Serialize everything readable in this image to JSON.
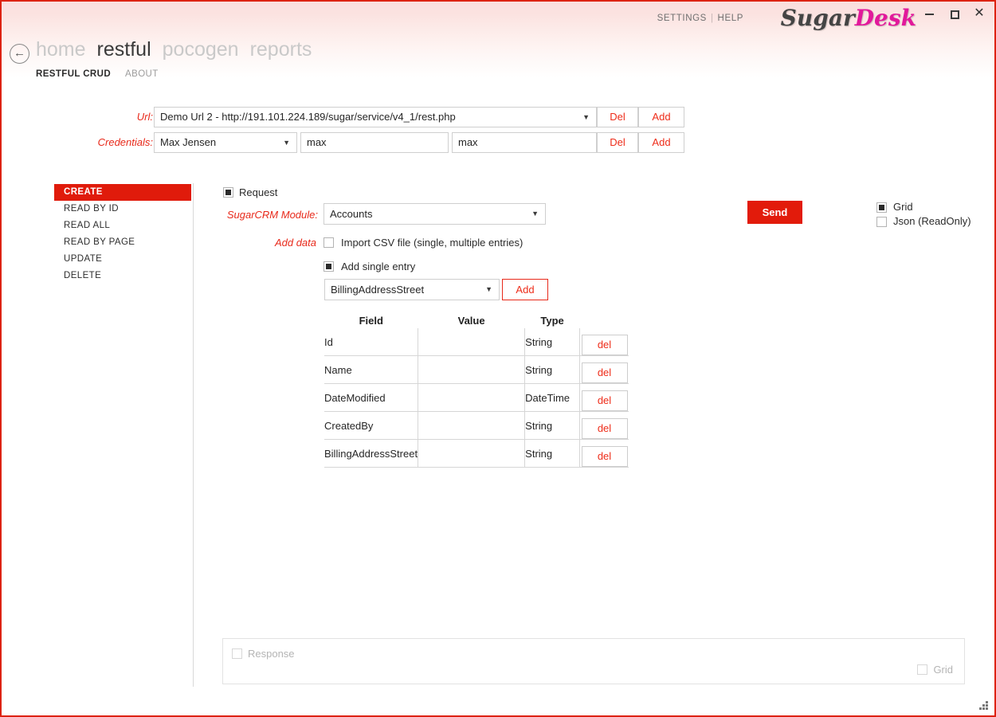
{
  "titlebar": {
    "settings_label": "SETTINGS",
    "separator": "|",
    "help_label": "HELP",
    "brand_part1": "Sugar",
    "brand_part2": "Desk",
    "minimize_label": "",
    "maximize_label": "",
    "close_label": "✕"
  },
  "nav": {
    "back_icon": "←",
    "items": [
      {
        "label": "home",
        "active": false
      },
      {
        "label": "restful",
        "active": true
      },
      {
        "label": "pocogen",
        "active": false
      },
      {
        "label": "reports",
        "active": false
      }
    ],
    "subitems": [
      {
        "label": "RESTFUL CRUD",
        "active": true
      },
      {
        "label": "ABOUT",
        "active": false
      }
    ]
  },
  "connection": {
    "url_label": "Url:",
    "url_value": "Demo Url 2 - http://191.101.224.189/sugar/service/v4_1/rest.php",
    "url_del_label": "Del",
    "url_add_label": "Add",
    "credentials_label": "Credentials:",
    "credentials_user_value": "Max Jensen",
    "credentials_login_value": "max",
    "credentials_password_value": "max",
    "credentials_del_label": "Del",
    "credentials_add_label": "Add",
    "dropdown_arrow": "▼"
  },
  "sidebar": {
    "items": [
      {
        "label": "CREATE",
        "active": true
      },
      {
        "label": "READ BY ID",
        "active": false
      },
      {
        "label": "READ ALL",
        "active": false
      },
      {
        "label": "READ BY PAGE",
        "active": false
      },
      {
        "label": "UPDATE",
        "active": false
      },
      {
        "label": "DELETE",
        "active": false
      }
    ]
  },
  "request": {
    "request_label": "Request",
    "request_checked": true,
    "module_label": "SugarCRM Module:",
    "module_value": "Accounts",
    "add_data_label": "Add data",
    "csv_label": "Import CSV file (single, multiple entries)",
    "csv_checked": false,
    "single_entry_label": "Add single entry",
    "single_entry_checked": true,
    "field_select_value": "BillingAddressStreet",
    "field_add_label": "Add",
    "dropdown_arrow": "▼"
  },
  "table": {
    "headers": [
      "Field",
      "Value",
      "Type"
    ],
    "del_label": "del",
    "rows": [
      {
        "field": "Id",
        "value": "",
        "type": "String"
      },
      {
        "field": "Name",
        "value": "",
        "type": "String"
      },
      {
        "field": "DateModified",
        "value": "",
        "type": "DateTime"
      },
      {
        "field": "CreatedBy",
        "value": "",
        "type": "String"
      },
      {
        "field": "BillingAddressStreet",
        "value": "",
        "type": "String"
      }
    ]
  },
  "actions": {
    "send_label": "Send",
    "grid_label": "Grid",
    "grid_checked": true,
    "json_label": "Json (ReadOnly)",
    "json_checked": false
  },
  "response": {
    "response_label": "Response",
    "response_checked": false,
    "grid_label": "Grid",
    "grid_checked": false
  },
  "colors": {
    "accent_red": "#e21b0b",
    "label_red": "#e8291a",
    "brand_pink": "#e2199b",
    "window_border": "#dd2211"
  }
}
